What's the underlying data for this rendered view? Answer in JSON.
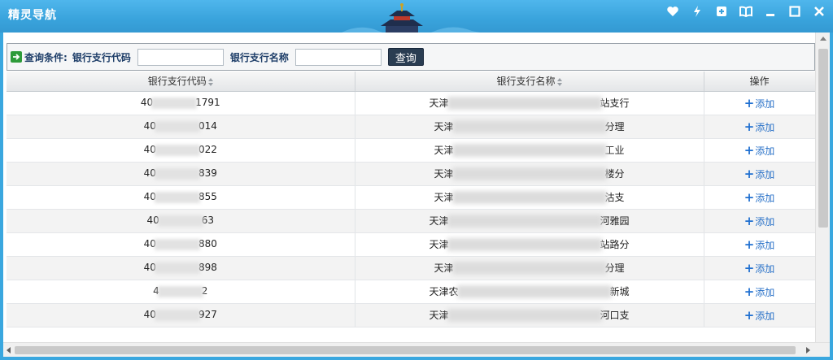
{
  "window": {
    "title": "精灵导航",
    "buttons": [
      "heart-icon",
      "bolt-icon",
      "plus-square-icon",
      "book-icon",
      "minimize-icon",
      "maximize-icon",
      "close-icon"
    ]
  },
  "search": {
    "label_condition": "查询条件:",
    "label_code": "银行支行代码",
    "code_value": "",
    "label_name": "银行支行名称",
    "name_value": "",
    "button": "查询"
  },
  "table": {
    "headers": {
      "code": "银行支行代码",
      "name": "银行支行名称",
      "action": "操作"
    },
    "rows": [
      {
        "code_pre": "40",
        "code_post": "1791",
        "name_pre": "天津",
        "name_post": "站支行",
        "action": "添加"
      },
      {
        "code_pre": "40",
        "code_post": "014",
        "name_pre": "天津",
        "name_post": "分理",
        "action": "添加"
      },
      {
        "code_pre": "40",
        "code_post": "022",
        "name_pre": "天津",
        "name_post": "工业",
        "action": "添加"
      },
      {
        "code_pre": "40",
        "code_post": "839",
        "name_pre": "天津",
        "name_post": "楼分",
        "action": "添加"
      },
      {
        "code_pre": "40",
        "code_post": "855",
        "name_pre": "天津",
        "name_post": "沽支",
        "action": "添加"
      },
      {
        "code_pre": "40",
        "code_post": "63",
        "name_pre": "天津",
        "name_post": "河雅园",
        "action": "添加"
      },
      {
        "code_pre": "40",
        "code_post": "880",
        "name_pre": "天津",
        "name_post": "站路分",
        "action": "添加"
      },
      {
        "code_pre": "40",
        "code_post": "898",
        "name_pre": "天津",
        "name_post": "分理",
        "action": "添加"
      },
      {
        "code_pre": "4",
        "code_post": "2",
        "name_pre": "天津农",
        "name_post": "新城",
        "action": "添加"
      },
      {
        "code_pre": "40",
        "code_post": "927",
        "name_pre": "天津",
        "name_post": "河口支",
        "action": "添加"
      }
    ]
  }
}
